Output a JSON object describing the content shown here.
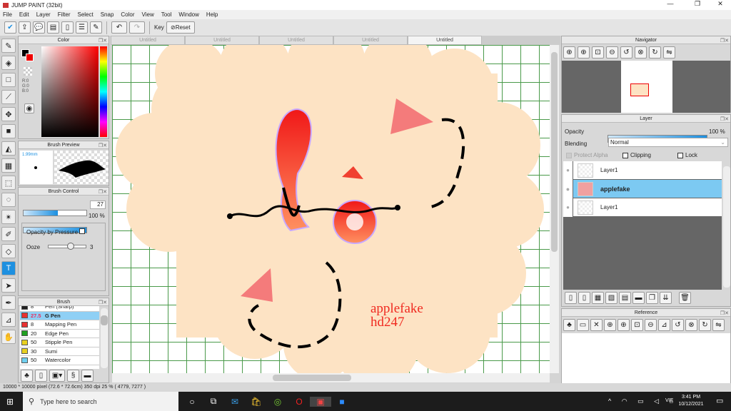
{
  "window": {
    "title": "JUMP PAINT (32bit)",
    "min": "—",
    "max": "❐",
    "close": "✕"
  },
  "menu": [
    "File",
    "Edit",
    "Layer",
    "Filter",
    "Select",
    "Snap",
    "Color",
    "View",
    "Tool",
    "Window",
    "Help"
  ],
  "toolbar": {
    "key_label": "Key",
    "reset_label": "Reset"
  },
  "panels": {
    "color": {
      "title": "Color",
      "r": "R:0",
      "g": "G:0",
      "b": "B:0"
    },
    "brush_preview": {
      "title": "Brush Preview",
      "size": "1.99mm"
    },
    "brush_control": {
      "title": "Brush Control",
      "size": "27",
      "opacity": "100 %",
      "opacity_by_pressure": "Opacity by Pressure",
      "ooze_label": "Ooze",
      "ooze_value": "3",
      "size_fraction": 0.55,
      "ooze_fraction": 0.6
    },
    "brush": {
      "title": "Brush",
      "items": [
        {
          "size": "8",
          "name": "Pen (Sharp)",
          "color": "#222222"
        },
        {
          "size": "27.5",
          "name": "G Pen",
          "color": "#e83030",
          "selected": true
        },
        {
          "size": "8",
          "name": "Mapping Pen",
          "color": "#e83030"
        },
        {
          "size": "20",
          "name": "Edge Pen",
          "color": "#20a020"
        },
        {
          "size": "50",
          "name": "Stipple Pen",
          "color": "#e8d020"
        },
        {
          "size": "30",
          "name": "Sumi",
          "color": "#e8d020"
        },
        {
          "size": "50",
          "name": "Watercolor",
          "color": "#70d0f0"
        }
      ]
    },
    "navigator": {
      "title": "Navigator"
    },
    "layer": {
      "title": "Layer",
      "opacity_label": "Opacity",
      "opacity_value": "100 %",
      "blending_label": "Blending",
      "blending_value": "Normal",
      "protect_alpha": "Protect Alpha",
      "clipping": "Clipping",
      "lock": "Lock",
      "layers": [
        {
          "name": "Layer1"
        },
        {
          "name": "applefake",
          "selected": true
        },
        {
          "name": "Layer1"
        }
      ]
    },
    "reference": {
      "title": "Reference"
    }
  },
  "tabs": [
    "Untitled",
    "Untitled",
    "Untitled",
    "Untitled",
    "Untitled"
  ],
  "canvas_text": {
    "line1": "applefake",
    "line2": "hd247"
  },
  "status": "10000 * 10000 pixel   (72.6 * 72.6cm)   350 dpi   25 %   ( 4779, 7277 )",
  "taskbar": {
    "search_placeholder": "Type here to search",
    "lang": "VIE",
    "time": "3:41 PM",
    "date": "10/12/2021"
  },
  "colors": {
    "accent": "#1a8fe0",
    "cream": "#fde3c4",
    "red": "#f02a20"
  }
}
